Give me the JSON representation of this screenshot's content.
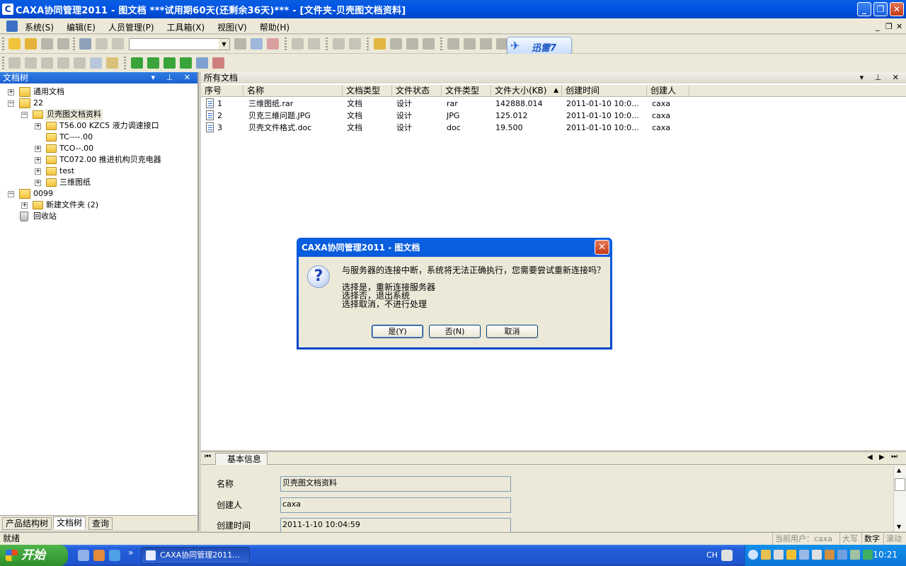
{
  "window": {
    "title": "CAXA协同管理2011 - 图文档    ***试用期60天(还剩余36天)*** - [文件夹-贝壳图文档资料]",
    "minimize": "_",
    "maximize": "❐",
    "close": "✕"
  },
  "menu": {
    "items": [
      "系统(S)",
      "编辑(E)",
      "人员管理(P)",
      "工具箱(X)",
      "视图(V)",
      "帮助(H)"
    ],
    "mdi_min": "_",
    "mdi_restore": "❐",
    "mdi_close": "✕"
  },
  "xunlei": {
    "label": "迅雷7"
  },
  "left_pane": {
    "title": "文档树",
    "controls": "▾ ⊥ ✕",
    "tree": [
      {
        "label": "通用文档",
        "level": 0,
        "expander": "+"
      },
      {
        "label": "22",
        "level": 0,
        "expander": "−"
      },
      {
        "label": "贝壳图文档资料",
        "level": 1,
        "expander": "−"
      },
      {
        "label": "T56.00 KZC5 液力调速接口",
        "level": 2,
        "expander": "+"
      },
      {
        "label": "TC----.00",
        "level": 2,
        "expander": ""
      },
      {
        "label": "TCO--.00",
        "level": 2,
        "expander": "+"
      },
      {
        "label": "TC072.00 推进机构贝克电器",
        "level": 2,
        "expander": "+"
      },
      {
        "label": "test",
        "level": 2,
        "expander": "+"
      },
      {
        "label": "三维图纸",
        "level": 2,
        "expander": "+"
      },
      {
        "label": "0099",
        "level": 0,
        "expander": "−"
      },
      {
        "label": "新建文件夹 (2)",
        "level": 1,
        "expander": "+"
      },
      {
        "label": "回收站",
        "level": 0,
        "expander": ""
      }
    ],
    "tabs": [
      "产品结构树",
      "文档树",
      "查询"
    ],
    "active_tab": "文档树"
  },
  "right_pane": {
    "title": "所有文档",
    "controls": "▾ ⊥ ✕",
    "columns": [
      "序号",
      "名称",
      "文档类型",
      "文件状态",
      "文件类型",
      "文件大小(KB)",
      "创建时间",
      "创建人"
    ],
    "sort_indicator": "▲",
    "rows": [
      [
        "1",
        "三维图纸.rar",
        "文档",
        "设计",
        "rar",
        "142888.014",
        "2011-01-10 10:0...",
        "caxa"
      ],
      [
        "2",
        "贝克三維问题.JPG",
        "文档",
        "设计",
        "JPG",
        "125.012",
        "2011-01-10 10:0...",
        "caxa"
      ],
      [
        "3",
        "贝壳文件格式.doc",
        "文档",
        "设计",
        "doc",
        "19.500",
        "2011-01-10 10:0...",
        "caxa"
      ]
    ]
  },
  "info_panel": {
    "tab": "基本信息",
    "nav_first": "⏮",
    "nav_prev": "◀",
    "nav_next": "▶",
    "nav_last": "⏭",
    "fields": [
      {
        "label": "名称",
        "value": "贝壳图文档资料"
      },
      {
        "label": "创建人",
        "value": "caxa"
      },
      {
        "label": "创建时间",
        "value": "2011-1-10 10:04:59"
      }
    ],
    "scroll_up": "▲",
    "scroll_down": "▼"
  },
  "statusbar": {
    "status": "就绪",
    "current_user": "当前用户：caxa",
    "caps": "大写",
    "num": "数字",
    "scroll": "滚动"
  },
  "taskbar": {
    "start": "开始",
    "task_label": "CAXA协同管理2011...",
    "lang": "CH",
    "clock": "10:21",
    "chevron": "»"
  },
  "dialog": {
    "title": "CAXA协同管理2011 - 图文档",
    "close": "✕",
    "icon": "?",
    "message": "与服务器的连接中断，系统将无法正确执行，您需要尝试重新连接吗？",
    "lines": [
      "选择是，重新连接服务器",
      "选择否，退出系统",
      "选择取消，不进行处理"
    ],
    "buttons": {
      "yes": "是(Y)",
      "no": "否(N)",
      "cancel": "取消"
    }
  },
  "colors": {
    "titlebar": "#0055e5",
    "desktop_chrome": "#ece9d8",
    "taskbar": "#245edb",
    "start": "#2d8f2b"
  }
}
